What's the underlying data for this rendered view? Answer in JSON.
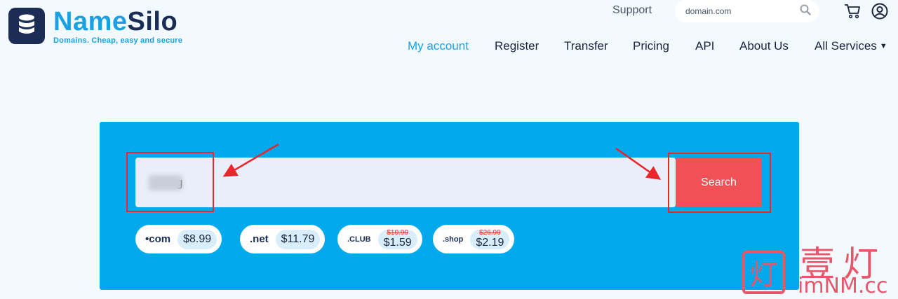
{
  "brand": {
    "name_part1": "Name",
    "name_part2": "Silo",
    "tagline": "Domains. Cheap, easy and secure"
  },
  "header": {
    "support_label": "Support",
    "search_placeholder": "domain.com",
    "icons": [
      "search-icon",
      "cart-icon",
      "user-icon"
    ]
  },
  "nav": {
    "items": [
      {
        "label": "My account",
        "active": true
      },
      {
        "label": "Register"
      },
      {
        "label": "Transfer"
      },
      {
        "label": "Pricing"
      },
      {
        "label": "API"
      },
      {
        "label": "About Us"
      },
      {
        "label": "All Services"
      }
    ],
    "dropdown_glyph": "▼"
  },
  "search": {
    "input_value": "g",
    "button_label": "Search"
  },
  "tlds": [
    {
      "name": "•com",
      "price": "$8.99"
    },
    {
      "name": ".net",
      "price": "$11.79"
    },
    {
      "name": ".CLUB",
      "old_price": "$10.99",
      "price": "$1.59"
    },
    {
      "name": ".shop",
      "old_price": "$26.99",
      "price": "$2.19"
    }
  ],
  "watermark": {
    "stamp_char": "灯",
    "chinese": "壹灯",
    "site": "imNM.cc"
  },
  "colors": {
    "brand_blue": "#1ba1e2",
    "brand_navy": "#1b2c55",
    "panel_blue": "#00a8ec",
    "search_button": "#ef5156",
    "annotation_red": "#e8262b"
  }
}
